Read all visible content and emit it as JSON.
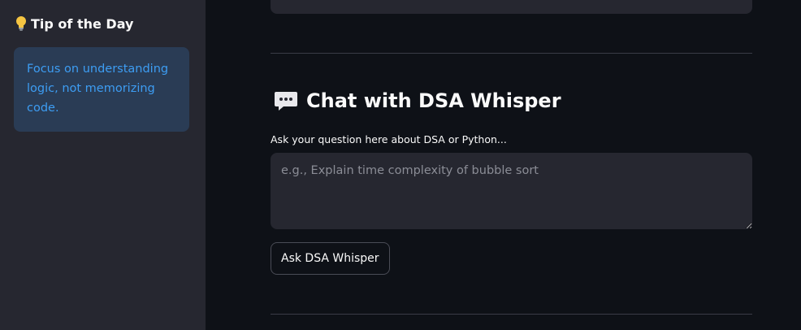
{
  "sidebar": {
    "tip_title": "Tip of the Day",
    "tip_icon": "lightbulb-icon",
    "tip_text": "Focus on understanding logic, not memorizing code."
  },
  "chat": {
    "title": "Chat with DSA Whisper",
    "title_icon": "speech-bubble-icon",
    "input_label": "Ask your question here about DSA or Python...",
    "input_placeholder": "e.g., Explain time complexity of bubble sort",
    "input_value": "",
    "button_label": "Ask DSA Whisper"
  },
  "colors": {
    "sidebar_bg": "#262730",
    "main_bg": "#0e1117",
    "tip_box_bg": "#2a3c55",
    "tip_text": "#3d9df3",
    "text": "#fafafa"
  }
}
